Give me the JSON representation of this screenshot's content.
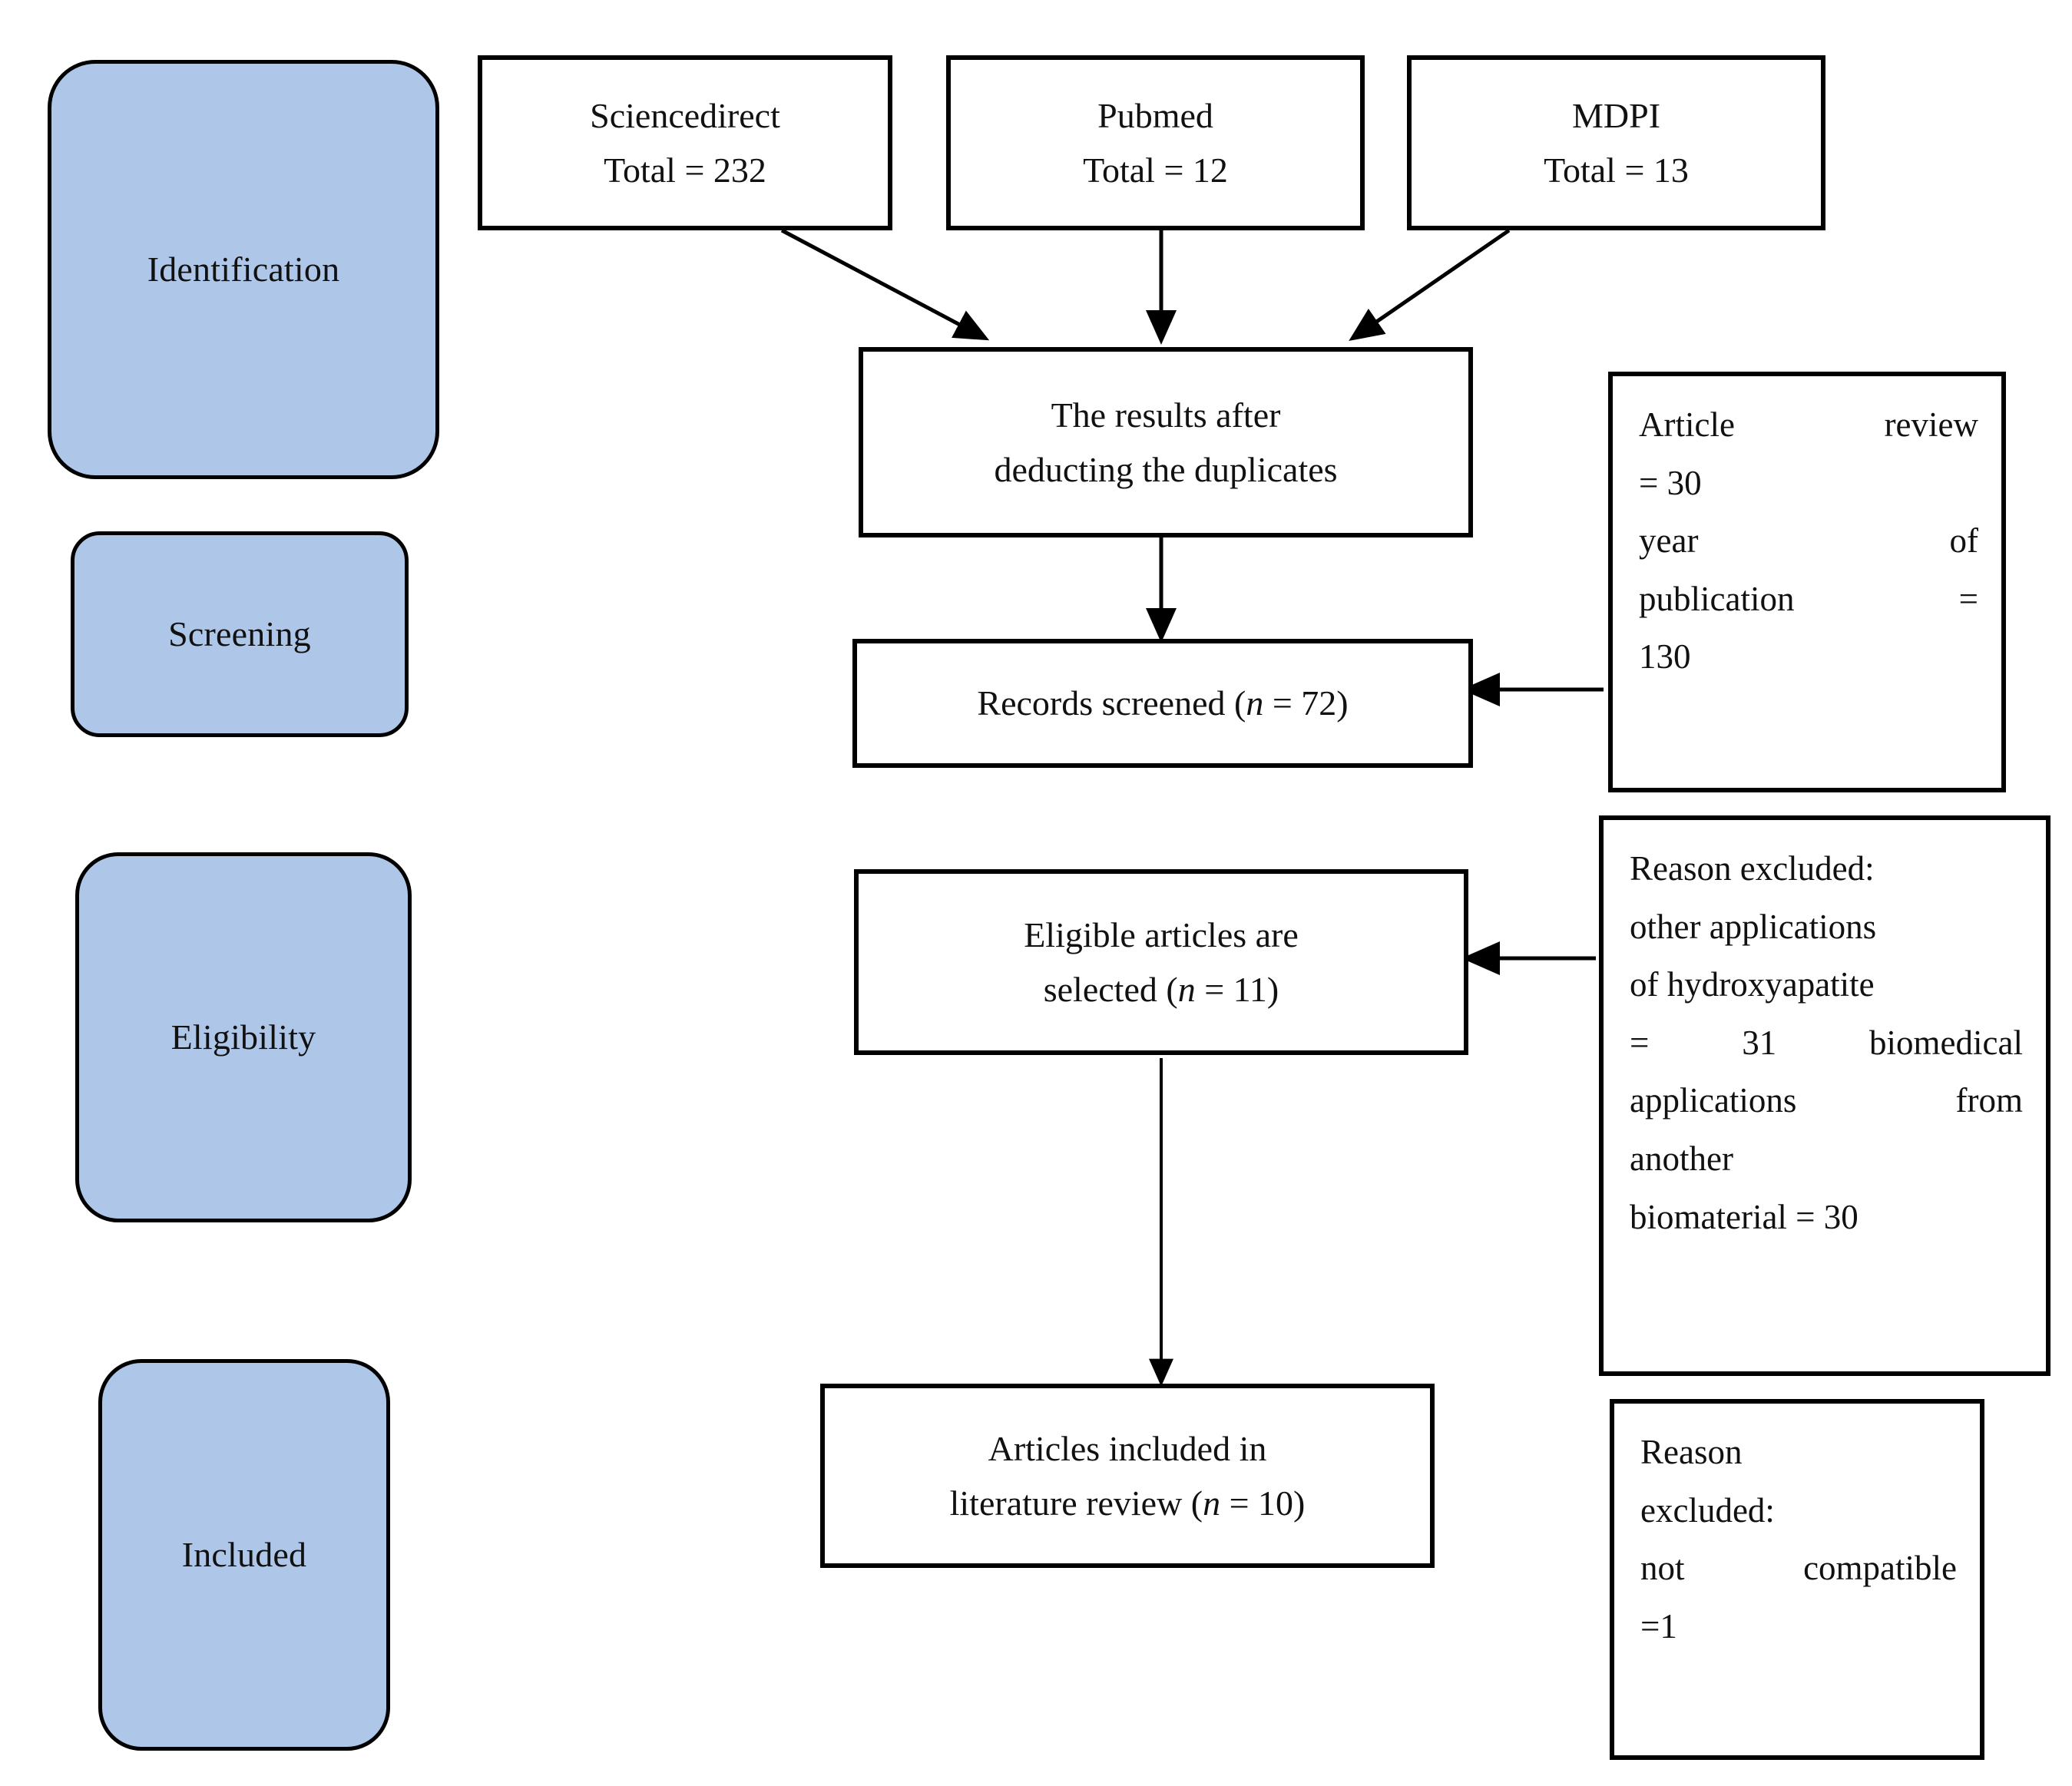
{
  "diagram": {
    "title": "PRISMA literature selection flow diagram",
    "accent_blue": "#AEC6E8",
    "line_color": "#000000",
    "background": "#FFFFFF"
  },
  "stages": [
    {
      "id": "identification",
      "label": "Identification"
    },
    {
      "id": "screening",
      "label": "Screening"
    },
    {
      "id": "eligibility",
      "label": "Eligibility"
    },
    {
      "id": "included",
      "label": "Included"
    }
  ],
  "sources": [
    {
      "id": "sciencedirect",
      "name": "Sciencedirect",
      "total_line": "Total = 232",
      "total": 232
    },
    {
      "id": "pubmed",
      "name": "Pubmed",
      "total_line": "Total = 12",
      "total": 12
    },
    {
      "id": "mdpi",
      "name": "MDPI",
      "total_line": "Total = 13",
      "total": 13
    }
  ],
  "process": {
    "dedup": {
      "line1": "The results after",
      "line2": "deducting the duplicates"
    },
    "screened": {
      "prefix": "Records screened (",
      "n_symbol": "n",
      "suffix": " = 72)",
      "count": 72
    },
    "eligible": {
      "line1": "Eligible articles are",
      "line2_prefix": "selected (",
      "n_symbol": "n",
      "line2_suffix": " = 11)",
      "count": 11
    },
    "included": {
      "line1": "Articles included in",
      "line2_prefix": "literature review (",
      "n_symbol": "n",
      "line2_suffix": " = 10)",
      "count": 10
    }
  },
  "exclusions": {
    "screening_note": {
      "lines": [
        [
          "Article",
          "review"
        ],
        [
          "= 30"
        ],
        [
          "year",
          "of"
        ],
        [
          "publication",
          "="
        ],
        [
          "130"
        ]
      ],
      "plain_text": "Article review = 30 year of publication = 130",
      "article_review": 30,
      "year_of_publication": 130
    },
    "eligibility_note": {
      "lines": [
        [
          "Reason excluded:"
        ],
        [
          "other applications"
        ],
        [
          "of hydroxyapatite"
        ],
        [
          "=",
          "31",
          "biomedical"
        ],
        [
          "applications",
          "from"
        ],
        [
          "another"
        ],
        [
          "biomaterial = 30"
        ]
      ],
      "plain_text": "Reason excluded: other applications of hydroxyapatite = 31 biomedical applications from another biomaterial = 30",
      "other_applications_of_hydroxyapatite": 31,
      "biomedical_applications_from_another_biomaterial": 30
    },
    "included_note": {
      "lines": [
        [
          "Reason"
        ],
        [
          "excluded:"
        ],
        [
          "not",
          "compatible"
        ],
        [
          "=1"
        ]
      ],
      "plain_text": "Reason excluded: not compatible =1",
      "not_compatible": 1
    }
  }
}
